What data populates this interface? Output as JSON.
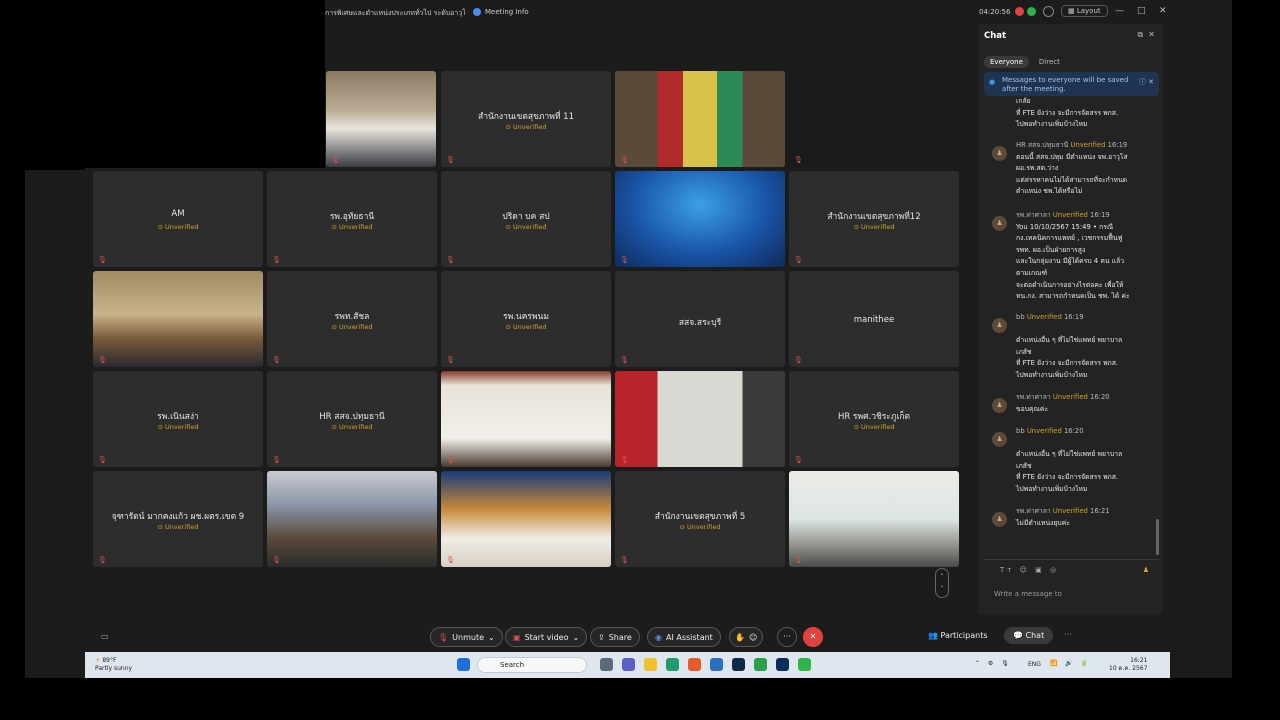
{
  "window": {
    "meeting_title": "การพิเศษและตำแหน่งประเภททั่วไป ระดับอาวุโส...",
    "meeting_info": "Meeting Info",
    "time": "04:20:56",
    "layout_label": "Layout",
    "minimize": "—",
    "maximize": "□",
    "close": "✕"
  },
  "status_unverified": "Unverified",
  "tiles": [
    {
      "name": "",
      "status": "",
      "video": "room-people"
    },
    {
      "name": "สำนักงานเขตสุขภาพที่ 11",
      "status": "Unverified",
      "video": ""
    },
    {
      "name": "",
      "status": "",
      "video": "stage-red"
    },
    {
      "name": "",
      "status": "",
      "video": "black"
    },
    {
      "name": "AM",
      "status": "Unverified",
      "video": ""
    },
    {
      "name": "รพ.อุทัยธานี",
      "status": "Unverified",
      "video": ""
    },
    {
      "name": "ปริดา บค สป",
      "status": "Unverified",
      "video": ""
    },
    {
      "name": "",
      "status": "",
      "video": "banner-blue"
    },
    {
      "name": "สำนักงานเขตสุขภาพที่12",
      "status": "Unverified",
      "video": ""
    },
    {
      "name": "",
      "status": "",
      "video": "room-wood"
    },
    {
      "name": "รพท.สัชล",
      "status": "Unverified",
      "video": ""
    },
    {
      "name": "รพ.นครพนม",
      "status": "Unverified",
      "video": ""
    },
    {
      "name": "สสจ.สระบุรี",
      "status": "",
      "video": ""
    },
    {
      "name": "manithee",
      "status": "",
      "video": ""
    },
    {
      "name": "รพ.เนินสง่า",
      "status": "Unverified",
      "video": ""
    },
    {
      "name": "HR สสจ.ปทุมธานี",
      "status": "Unverified",
      "video": ""
    },
    {
      "name": "",
      "status": "",
      "video": "room-wall"
    },
    {
      "name": "",
      "status": "",
      "video": "office-red"
    },
    {
      "name": "HR รพศ.วชิระภูเก็ต",
      "status": "Unverified",
      "video": ""
    },
    {
      "name": "จุฑารัตน์ มากคงแก้ว ผช.ผตร.เขต 9",
      "status": "Unverified",
      "video": ""
    },
    {
      "name": "",
      "status": "",
      "video": "conference-hall"
    },
    {
      "name": "",
      "status": "",
      "video": "banner-speaker"
    },
    {
      "name": "สำนักงานเขตสุขภาพที่ 5",
      "status": "Unverified",
      "video": ""
    },
    {
      "name": "",
      "status": "",
      "video": "office-person"
    }
  ],
  "toolbar": {
    "unmute": "Unmute",
    "start_video": "Start video",
    "share": "Share",
    "ai_assistant": "AI Assistant",
    "participants": "Participants",
    "chat": "Chat"
  },
  "chat": {
    "title": "Chat",
    "tab_everyone": "Everyone",
    "tab_direct": "Direct",
    "notice": "Messages to everyone will be saved after the meeting.",
    "messages": [
      {
        "sender": "",
        "unverified": "",
        "time": "",
        "lines": [
          "เกลัย",
          "ที่ FTE ยังว่าง จะมีการจัดสรร พกส.",
          "ไปพอทำงานเพิ่มบ้างไหม"
        ]
      },
      {
        "sender": "HR สสจ.ปทุมธานี",
        "unverified": "Unverified",
        "time": "16:19",
        "lines": [
          "ตอนนี้ สสจ.ปทุม มีตำแหน่ง จพ.อาวุโส",
          "ผอ.รพ.สต.ว่าง",
          "แต่สรรหาคนไม่ได้สามารถที่จะกำหนด",
          "ตำแหน่ง ชพ.ได้หรือไม่"
        ]
      },
      {
        "sender": "รพ.ท่าศาลา",
        "unverified": "Unverified",
        "time": "16:19",
        "lines": [
          "You 10/10/2567 15:49 • กรณี",
          "กง.เทคนิคการแพทย์ , เวชกรรมฟื้นฟู",
          "รพท. ผอ.เป็นฝ่ายการสูง",
          "และในกลุ่มงาน มีผู้ได้ครบ 4 คน แล้ว",
          "ตามเกณฑ์",
          "จะต่อดำเนินการอย่างไรต่อคะ เพื่อให้",
          "ทน.กง. สามารถกำหนดเป็น ชพ. ได้ ค่ะ"
        ]
      },
      {
        "sender": "bb",
        "unverified": "Unverified",
        "time": "16:19",
        "lines": [
          "",
          "ตำแหน่งอื่น ๆ ที่ไม่ใช่แพทย์ พยาบาล",
          "เภสัช",
          "ที่ FTE ยังว่าง จะมีการจัดสรร พกส.",
          "ไปพอทำงานเพิ่มบ้างไหม"
        ]
      },
      {
        "sender": "รพ.ท่าศาลา",
        "unverified": "Unverified",
        "time": "16:20",
        "lines": [
          "ขอบคุณค่ะ"
        ]
      },
      {
        "sender": "bb",
        "unverified": "Unverified",
        "time": "16:20",
        "lines": [
          "",
          "ตำแหน่งอื่น ๆ ที่ไม่ใช่แพทย์ พยาบาล",
          "เภสัช",
          "ที่ FTE ยังว่าง จะมีการจัดสรร พกส.",
          "ไปพอทำงานเพิ่มบ้างไหม"
        ]
      },
      {
        "sender": "รพ.ท่าศาลา",
        "unverified": "Unverified",
        "time": "16:21",
        "lines": [
          "ไม่มีตำแหน่งยุบค่ะ"
        ]
      }
    ],
    "compose_placeholder": "Write a message to"
  },
  "taskbar": {
    "weather_temp": "89°F",
    "weather_desc": "Partly sunny",
    "search": "Search",
    "lang": "ENG",
    "clock_time": "16:21",
    "clock_date": "10 ต.ค. 2567"
  },
  "colors": {
    "unverified": "#d4a22c",
    "end_call": "#e0433f",
    "chat_tab": "#3a3a3a",
    "notice_bg": "#1f3450"
  }
}
